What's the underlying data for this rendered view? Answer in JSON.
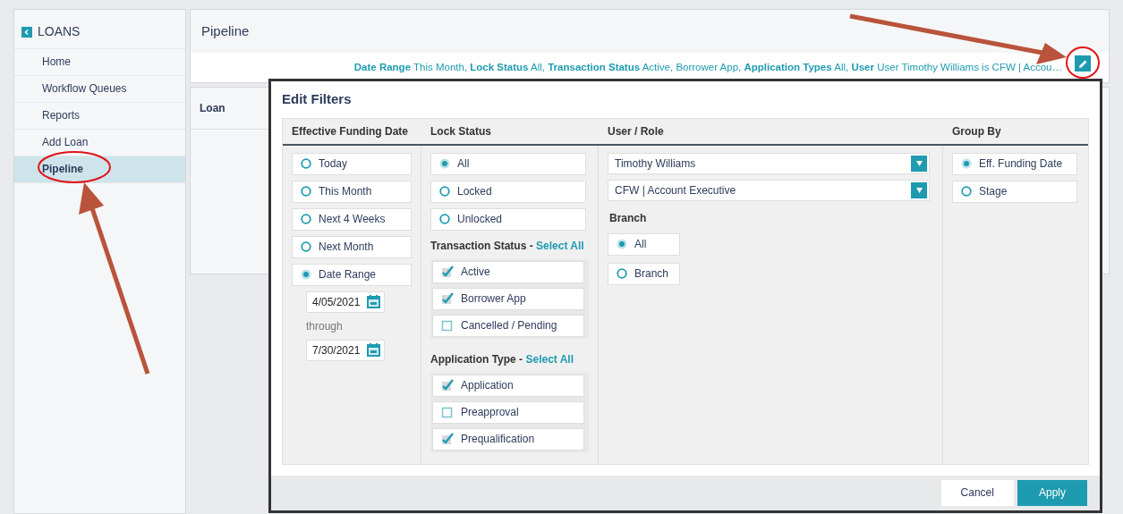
{
  "sidebar": {
    "title": "LOANS",
    "items": [
      {
        "label": "Home",
        "selected": false
      },
      {
        "label": "Workflow Queues",
        "selected": false
      },
      {
        "label": "Reports",
        "selected": false
      },
      {
        "label": "Add Loan",
        "selected": false
      },
      {
        "label": "Pipeline",
        "selected": true
      }
    ]
  },
  "page_title": "Pipeline",
  "filter_summary": "**Date Range** This Month, **Lock Status** All, **Transaction Status** Active, Borrower App, **Application Types** All, **User** User Timothy Williams is CFW | Accou…",
  "table": {
    "columns": [
      "Loan"
    ]
  },
  "modal": {
    "title": "Edit Filters",
    "funding_date": {
      "heading": "Effective Funding Date",
      "options": [
        {
          "label": "Today",
          "selected": false
        },
        {
          "label": "This Month",
          "selected": false
        },
        {
          "label": "Next 4 Weeks",
          "selected": false
        },
        {
          "label": "Next Month",
          "selected": false
        },
        {
          "label": "Date Range",
          "selected": true
        }
      ],
      "from": "4/05/2021",
      "through_label": "through",
      "to": "7/30/2021"
    },
    "lock_status": {
      "heading": "Lock Status",
      "options": [
        {
          "label": "All",
          "selected": true
        },
        {
          "label": "Locked",
          "selected": false
        },
        {
          "label": "Unlocked",
          "selected": false
        }
      ]
    },
    "transaction_status": {
      "heading": "Transaction Status -",
      "select_all": "Select All",
      "options": [
        {
          "label": "Active",
          "checked": true
        },
        {
          "label": "Borrower App",
          "checked": true
        },
        {
          "label": "Cancelled / Pending",
          "checked": false
        }
      ]
    },
    "application_type": {
      "heading": "Application Type -",
      "select_all": "Select All",
      "options": [
        {
          "label": "Application",
          "checked": true
        },
        {
          "label": "Preapproval",
          "checked": false
        },
        {
          "label": "Prequalification",
          "checked": true
        }
      ]
    },
    "user_role": {
      "heading": "User / Role",
      "user": "Timothy Williams",
      "role": "CFW | Account Executive",
      "branch_heading": "Branch",
      "branch_options": [
        {
          "label": "All",
          "selected": true
        },
        {
          "label": "Branch",
          "selected": false
        }
      ]
    },
    "group_by": {
      "heading": "Group By",
      "options": [
        {
          "label": "Eff. Funding Date",
          "selected": true
        },
        {
          "label": "Stage",
          "selected": false
        }
      ]
    },
    "buttons": [
      {
        "label": "Cancel",
        "kind": "secondary"
      },
      {
        "label": "Apply",
        "kind": "primary"
      }
    ]
  }
}
